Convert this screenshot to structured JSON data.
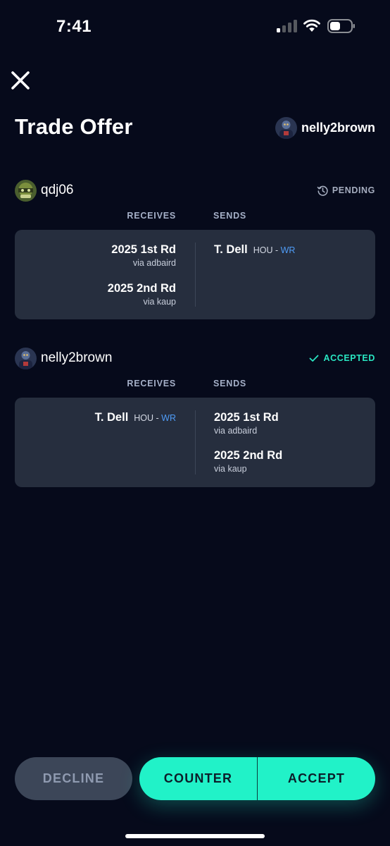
{
  "status_bar": {
    "time": "7:41"
  },
  "header": {
    "title": "Trade Offer",
    "user": "nelly2brown"
  },
  "sections": [
    {
      "owner": "qdj06",
      "status": "PENDING",
      "receives_label": "RECEIVES",
      "sends_label": "SENDS",
      "receives": [
        {
          "title": "2025 1st Rd",
          "via": "via adbaird"
        },
        {
          "title": "2025 2nd Rd",
          "via": "via kaup"
        }
      ],
      "sends": [
        {
          "name": "T. Dell",
          "team": "HOU - ",
          "pos": "WR"
        }
      ]
    },
    {
      "owner": "nelly2brown",
      "status": "ACCEPTED",
      "receives_label": "RECEIVES",
      "sends_label": "SENDS",
      "receives": [
        {
          "name": "T. Dell",
          "team": "HOU - ",
          "pos": "WR"
        }
      ],
      "sends": [
        {
          "title": "2025 1st Rd",
          "via": "via adbaird"
        },
        {
          "title": "2025 2nd Rd",
          "via": "via kaup"
        }
      ]
    }
  ],
  "buttons": {
    "decline": "DECLINE",
    "counter": "COUNTER",
    "accept": "ACCEPT"
  },
  "colors": {
    "background": "#060a1b",
    "card": "#262e3e",
    "accent": "#21f2c8",
    "accepted": "#29e6c2",
    "position": "#4f9cf7"
  },
  "icons": {
    "close": "close-icon",
    "pending": "clock-history-icon",
    "accepted": "checkmark-icon"
  }
}
